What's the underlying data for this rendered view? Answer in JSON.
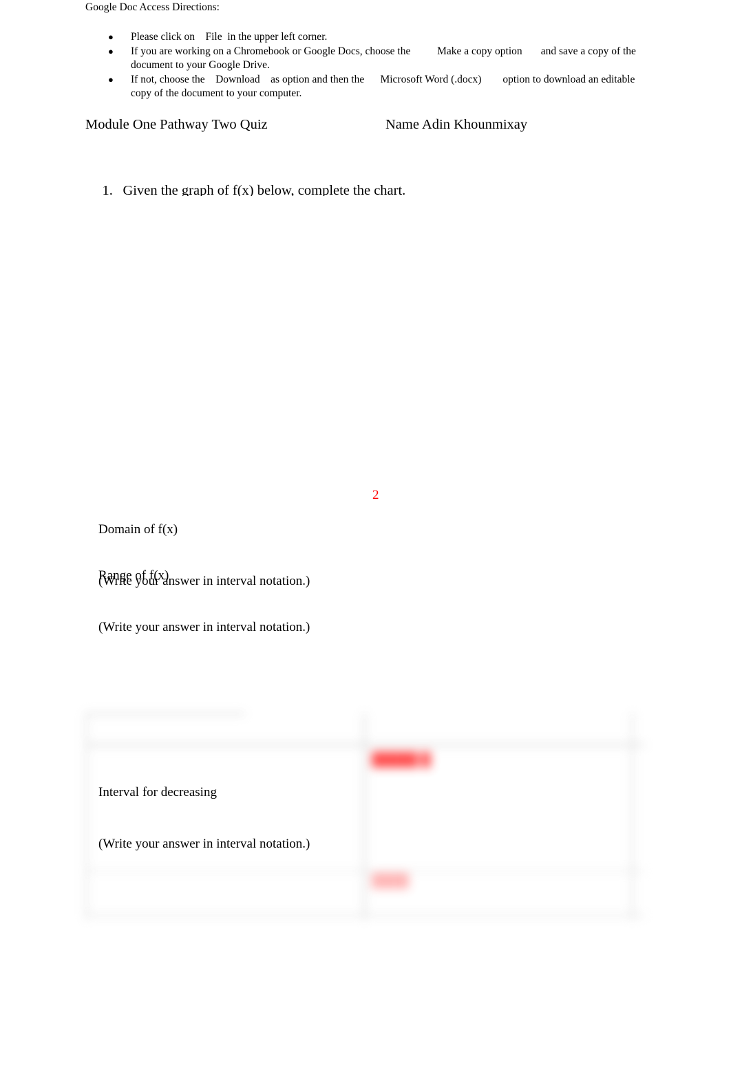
{
  "document": {
    "directions_heading": "Google Doc Access Directions:",
    "bullets": [
      {
        "marker": "●",
        "segments": [
          "Please click on",
          "File",
          "in the upper left corner."
        ],
        "text": "Please click on    File  in the upper left corner."
      },
      {
        "marker": "●",
        "segments": [
          "If you are working on a Chromebook or Google Docs, choose the",
          "Make a copy option",
          "and save a copy of the document to your Google Drive."
        ],
        "text": "If you are working on a Chromebook or Google Docs, choose the          Make a copy option       and save a copy of the document to your Google Drive."
      },
      {
        "marker": "●",
        "segments": [
          "If not, choose the",
          "Download",
          "as option and then the",
          "Microsoft Word (.docx)",
          "option to download an editable copy of the document to your computer."
        ],
        "text": "If not, choose the    Download    as option and then the      Microsoft Word (.docx)        option to download an editable copy of the document to your computer."
      }
    ],
    "quiz_title": "Module One Pathway Two Quiz",
    "name_label": "Name",
    "student_name": "Adin Khounmixay",
    "name_line": "Name Adin Khounmixay",
    "question_1": {
      "number": "1.",
      "prompt": "Given the graph of f(x) below, complete the chart."
    },
    "chart_rows": [
      {
        "label": "Domain of f(x)",
        "sublabel": "(Write your answer in interval notation.)",
        "answer": "2",
        "answer_color": "#ff0000"
      },
      {
        "label": "Range of f(x)",
        "sublabel": "(Write your answer in interval notation.)",
        "answer": "",
        "answer_color": "#ff0000"
      },
      {
        "label": "Interval for decreasing",
        "sublabel": "(Write your answer in interval notation.)",
        "answer": "",
        "answer_color": "#ff3b3b"
      }
    ],
    "blurred_answer_1": "█████ █",
    "blurred_answer_2": "████",
    "colors": {
      "text": "#000000",
      "answer_red": "#ff0000",
      "page_background": "#ffffff",
      "table_border": "#d6d6d6"
    }
  }
}
